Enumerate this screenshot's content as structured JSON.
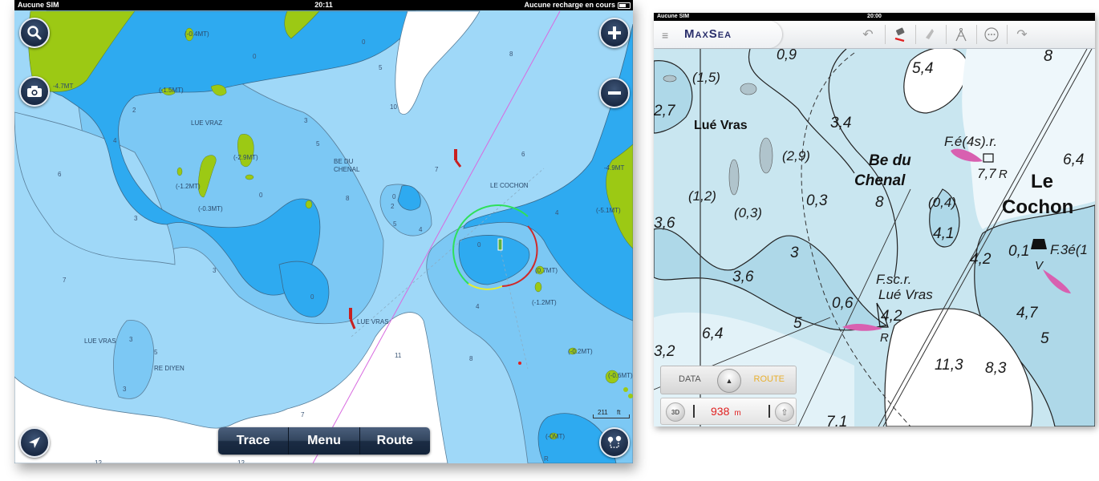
{
  "left_app": {
    "status_bar": {
      "carrier": "Aucune SIM",
      "time": "20:11",
      "battery_text": "Aucune recharge en cours"
    },
    "buttons": {
      "search": "search",
      "camera": "camera",
      "zoom_in": "+",
      "zoom_out": "−",
      "locate": "locate",
      "route_tool": "route"
    },
    "bottom_bar": {
      "trace": "Trace",
      "menu": "Menu",
      "route": "Route"
    },
    "scale": {
      "value": "211",
      "unit": "ft"
    },
    "place_labels": {
      "lue_vraz": "LUE VRAZ",
      "be_du_chenal_1": "BE DU",
      "be_du_chenal_2": "CHENAL",
      "le_cochon": "LE COCHON",
      "lue_vras_1": "LUE VRAS",
      "lue_vras_2": "LUE VRAS",
      "re_diyen": "RE DIYEN"
    },
    "rock_labels": {
      "r1": "(-0.4MT)",
      "r2": "-4.7MT",
      "r3": "(-1.5MT)",
      "r4": "(-2.9MT)",
      "r5": "(-1.2MT)",
      "r6": "(-0.3MT)",
      "r7": "-4.9MT",
      "r8": "(-5.1MT)",
      "r9": "(0.7MT)",
      "r10": "(-1.2MT)",
      "r11": "(-0.2MT)",
      "r12": "(-0.6MT)",
      "r13": "(-0MT)"
    },
    "soundings": {
      "s1": "0",
      "s2": "0",
      "s3": "5",
      "s4": "8",
      "s5": "10",
      "s6": "2",
      "s7": "3",
      "s8": "4",
      "s9": "5",
      "s10": "6",
      "s11": "0",
      "s12": "8",
      "s13": "0",
      "s14": "2",
      "s15": "5",
      "s16": "4",
      "s17": "7",
      "s18": "6",
      "s19": "4",
      "s20": "3",
      "s21": "3",
      "s22": "7",
      "s23": "0",
      "s24": "0",
      "s25": "4",
      "s26": "3",
      "s27": "5",
      "s28": "3",
      "s29": "11",
      "s30": "8",
      "s31": "7",
      "s32": "12",
      "s33": "12",
      "s34": "R"
    }
  },
  "right_app": {
    "status_bar": {
      "carrier": "Aucune SIM",
      "time": "20:00"
    },
    "brand": "MaxSea",
    "toolbar": {
      "undo": "undo",
      "draw": "draw",
      "erase": "erase",
      "compass": "compass",
      "more": "more",
      "redo": "redo"
    },
    "panel": {
      "data_tab": "DATA",
      "route_tab": "ROUTE",
      "btn_3d": "3D",
      "distance": "938",
      "distance_unit": "m"
    },
    "chart_text": {
      "t1": "0,9",
      "t2": "(1,5)",
      "t3": "5,4",
      "t4": "8",
      "t5": "2,7",
      "t6": "Lué Vras",
      "t7": "3,4",
      "t8": "F.é(4s).r.",
      "t9": "6,4",
      "t10": "(2,9)",
      "t11": "Be du",
      "t12": "Chenal",
      "t13": "7,7",
      "t14": "R",
      "t15": "Le",
      "t16": "Cochon",
      "t17": "(1,2)",
      "t18": "(0,3)",
      "t19": "0,3",
      "t20": "8",
      "t21": "(0,4)",
      "t22": "3,6",
      "t23": "4,1",
      "t24": "3",
      "t25": "4,2",
      "t26": "0,1",
      "t27": "F.3é(1",
      "t28": "V",
      "t29": "3,6",
      "t30": "F.sc.r.",
      "t31": "Lué Vras",
      "t32": "0,6",
      "t33": "4,2",
      "t34": "5",
      "t35": "R",
      "t36": "6,4",
      "t37": "3,2",
      "t38": "4,7",
      "t39": "11,3",
      "t40": "8,3",
      "t41": "5",
      "t42": "7,1"
    }
  },
  "colors": {
    "deep_water": "#9fd8f8",
    "mid_water": "#7cc8f4",
    "shallow_water": "#2eaaf0",
    "land_drying": "#9cc914",
    "land_white": "#ffffff",
    "button_navy": "#1a2a45",
    "route_red": "#e02020",
    "route_orange": "#e8b030",
    "brand_navy": "#2a2f6c",
    "paper_water": "#c9e6f0",
    "paper_shallow": "#aed8e8"
  }
}
